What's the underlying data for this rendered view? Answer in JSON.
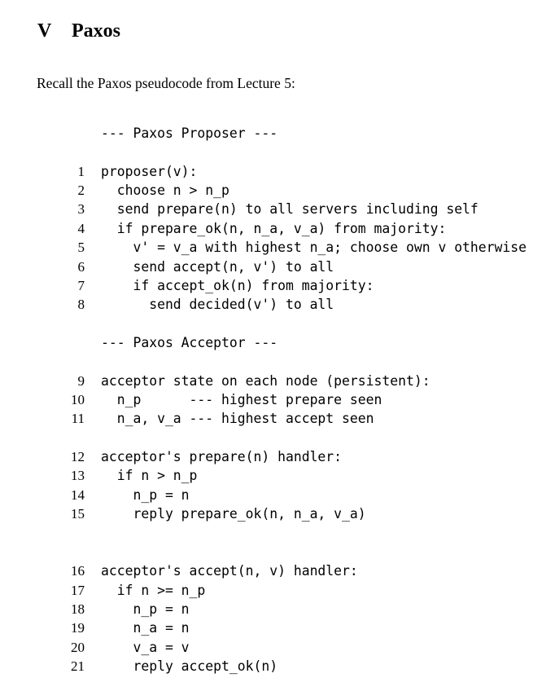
{
  "section": {
    "number": "V",
    "title": "Paxos"
  },
  "intro": "Recall the Paxos pseudocode from Lecture 5:",
  "proposer_header": "--- Paxos Proposer ---",
  "acceptor_header": "--- Paxos Acceptor ---",
  "lines": [
    {
      "n": "1",
      "text": "proposer(v):"
    },
    {
      "n": "2",
      "text": "  choose n > n_p"
    },
    {
      "n": "3",
      "text": "  send prepare(n) to all servers including self"
    },
    {
      "n": "4",
      "text": "  if prepare_ok(n, n_a, v_a) from majority:"
    },
    {
      "n": "5",
      "text": "    v' = v_a with highest n_a; choose own v otherwise"
    },
    {
      "n": "6",
      "text": "    send accept(n, v') to all"
    },
    {
      "n": "7",
      "text": "    if accept_ok(n) from majority:"
    },
    {
      "n": "8",
      "text": "      send decided(v') to all"
    },
    {
      "n": "9",
      "text": "acceptor state on each node (persistent):"
    },
    {
      "n": "10",
      "text": "  n_p      --- highest prepare seen"
    },
    {
      "n": "11",
      "text": "  n_a, v_a --- highest accept seen"
    },
    {
      "n": "12",
      "text": "acceptor's prepare(n) handler:"
    },
    {
      "n": "13",
      "text": "  if n > n_p"
    },
    {
      "n": "14",
      "text": "    n_p = n"
    },
    {
      "n": "15",
      "text": "    reply prepare_ok(n, n_a, v_a)"
    },
    {
      "n": "16",
      "text": "acceptor's accept(n, v) handler:"
    },
    {
      "n": "17",
      "text": "  if n >= n_p"
    },
    {
      "n": "18",
      "text": "    n_p = n"
    },
    {
      "n": "19",
      "text": "    n_a = n"
    },
    {
      "n": "20",
      "text": "    v_a = v"
    },
    {
      "n": "21",
      "text": "    reply accept_ok(n)"
    }
  ]
}
